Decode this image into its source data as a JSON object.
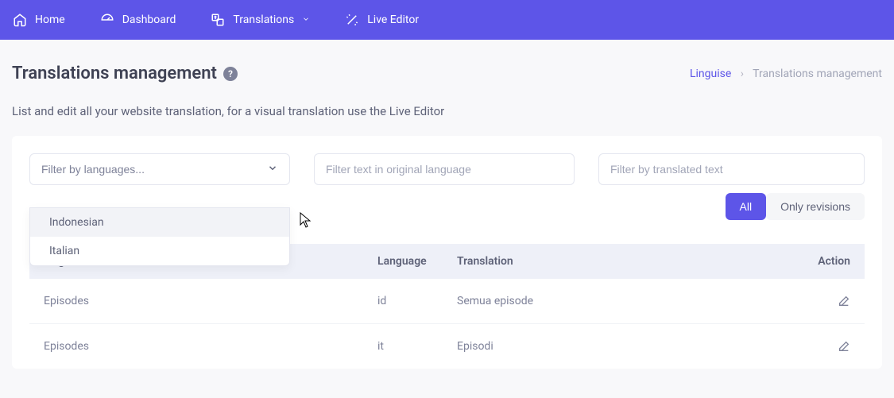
{
  "nav": {
    "home": "Home",
    "dashboard": "Dashboard",
    "translations": "Translations",
    "liveeditor": "Live Editor"
  },
  "page": {
    "title": "Translations management",
    "subtitle": "List and edit all your website translation, for a visual translation use the Live Editor"
  },
  "breadcrumb": {
    "root": "Linguise",
    "current": "Translations management"
  },
  "filters": {
    "lang_placeholder": "Filter by languages...",
    "original_placeholder": "Filter text in original language",
    "translated_placeholder": "Filter by translated text",
    "options": [
      "Indonesian",
      "Italian"
    ]
  },
  "toggle": {
    "all": "All",
    "revisions": "Only revisions"
  },
  "table": {
    "headers": {
      "original": "Original",
      "language": "Language",
      "translation": "Translation",
      "action": "Action"
    },
    "rows": [
      {
        "original": "Episodes",
        "language": "id",
        "translation": "Semua episode"
      },
      {
        "original": "Episodes",
        "language": "it",
        "translation": "Episodi"
      }
    ]
  }
}
